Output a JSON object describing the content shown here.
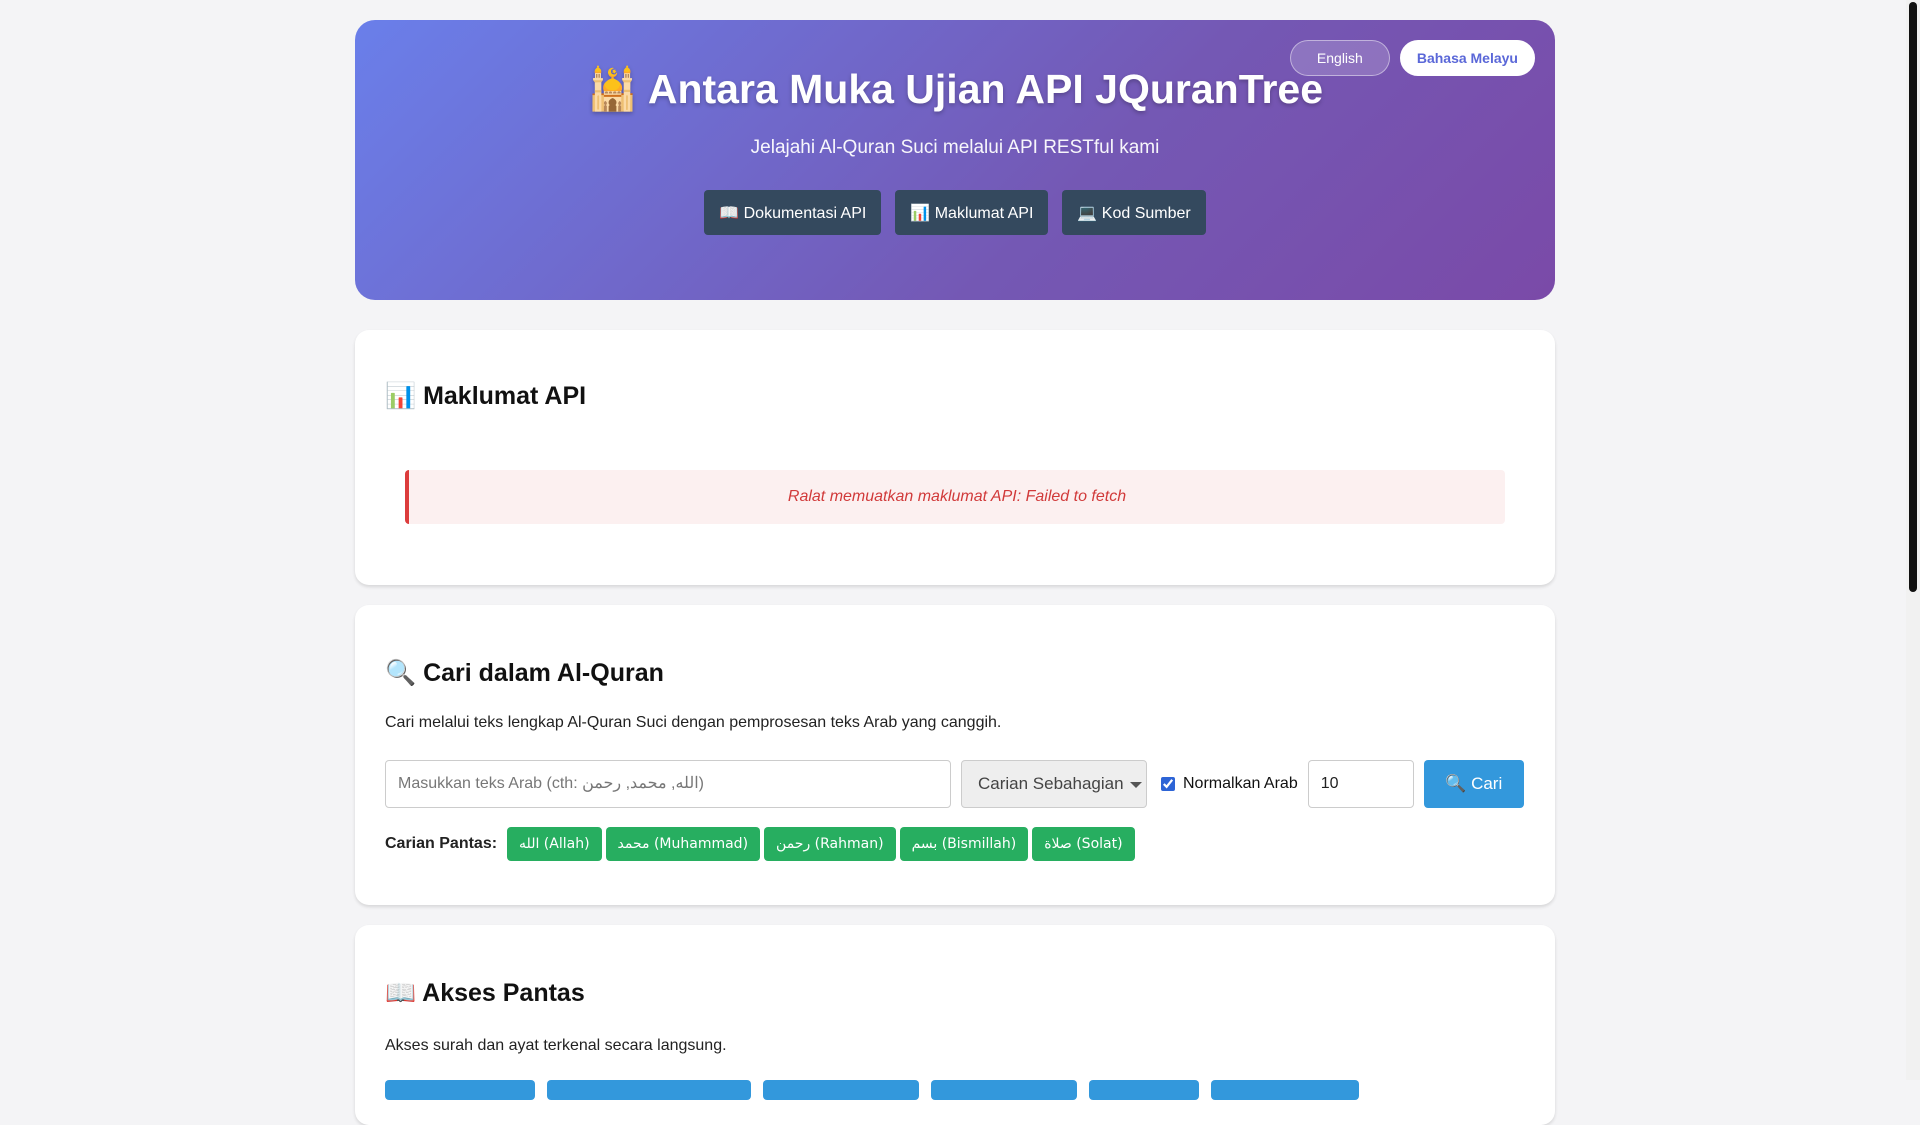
{
  "header": {
    "languages": [
      {
        "label": "English",
        "active": false
      },
      {
        "label": "Bahasa Melayu",
        "active": true
      }
    ],
    "title": "🕌 Antara Muka Ujian API JQuranTree",
    "subtitle": "Jelajahi Al-Quran Suci melalui API RESTful kami",
    "nav": [
      {
        "label": "📖 Dokumentasi API"
      },
      {
        "label": "📊 Maklumat API"
      },
      {
        "label": "💻 Kod Sumber"
      }
    ]
  },
  "api_info": {
    "title": "📊 Maklumat API",
    "error": "Ralat memuatkan maklumat API: Failed to fetch"
  },
  "search": {
    "title": "🔍 Cari dalam Al-Quran",
    "description": "Cari melalui teks lengkap Al-Quran Suci dengan pemprosesan teks Arab yang canggih.",
    "placeholder": "Masukkan teks Arab (cth: الله, محمد, رحمن)",
    "query": "",
    "mode_selected": "Carian Sebahagian",
    "normalize_label": "Normalkan Arab",
    "normalize_checked": true,
    "limit": "10",
    "button": "🔍 Cari",
    "quick_label": "Carian Pantas:",
    "quick": [
      "الله (Allah)",
      "محمد (Muhammad)",
      "رحمن (Rahman)",
      "بسم (Bismillah)",
      "صلاة (Solat)"
    ]
  },
  "quick_access": {
    "title": "📖 Akses Pantas",
    "description": "Akses surah dan ayat terkenal secara langsung."
  },
  "colors": {
    "hero_gradient_start": "#6a7fea",
    "hero_gradient_end": "#7a4aa8",
    "nav_button": "#34495e",
    "primary": "#3398dc",
    "quick_chip": "#27ae60",
    "error_text": "#d13a3a"
  }
}
